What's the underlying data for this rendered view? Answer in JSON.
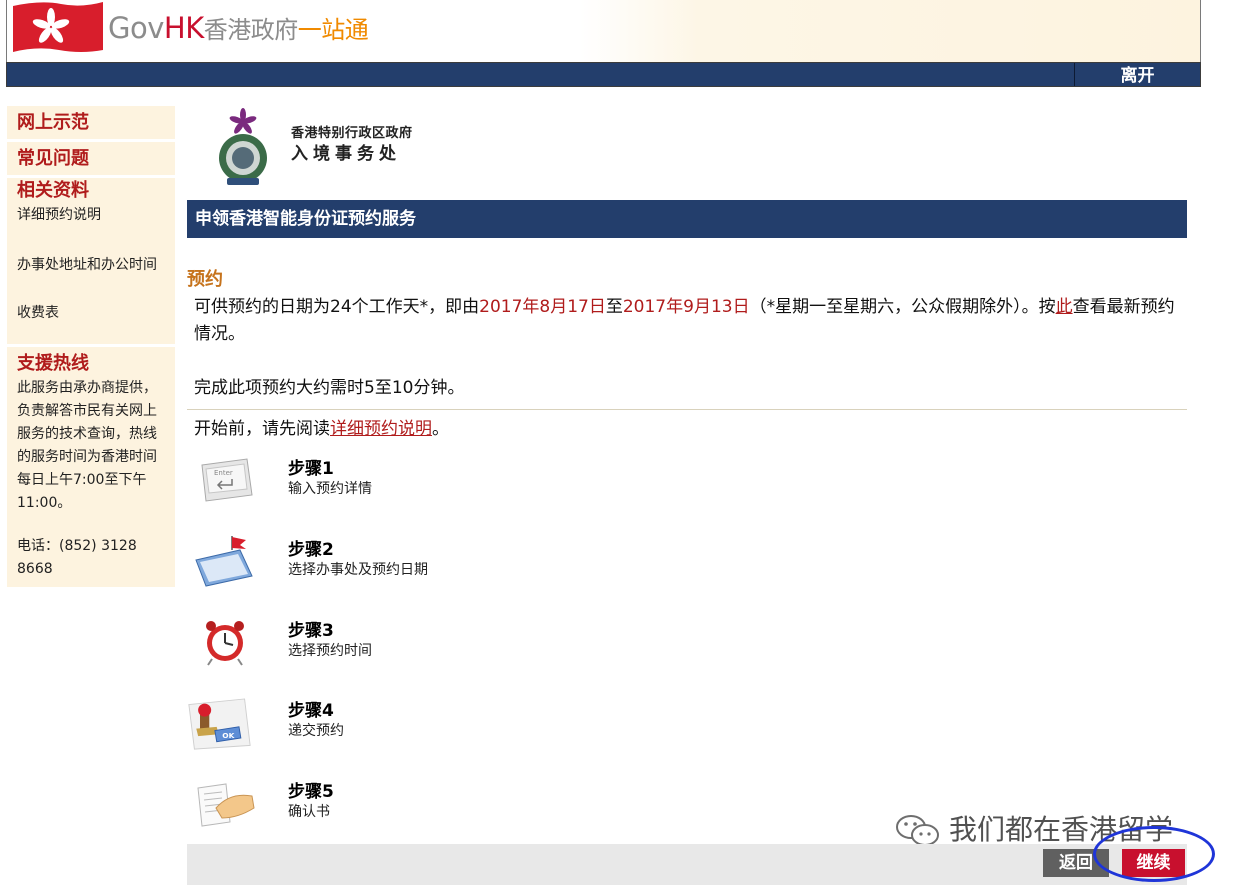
{
  "header": {
    "brand_gov": "Gov",
    "brand_hk": "HK",
    "brand_cn": "香港政府",
    "brand_cn_accent": "一站通",
    "exit_label": "离开"
  },
  "sidebar": {
    "demo": "网上示范",
    "faq": "常见问题",
    "related_head": "相关资料",
    "related_items": [
      "详细预约说明",
      "办事处地址和办公时间",
      "收费表"
    ],
    "hotline_head": "支援热线",
    "hotline_text": "此服务由承办商提供，负责解答市民有关网上服务的技术查询，热线的服务时间为香港时间每日上午7:00至下午11:00。",
    "phone": "电话：(852) 3128 8668"
  },
  "department": {
    "line1": "香港特别行政区政府",
    "line2": "入境事务处"
  },
  "page_title": "申领香港智能身份证预约服务",
  "booking": {
    "heading": "预约",
    "p1_a": "可供预约的日期为24个工作天*，即由",
    "date_from": "2017年8月17日",
    "p1_b": "至",
    "date_to": "2017年9月13日",
    "p1_c": "（*星期一至星期六，公众假期除外）。按",
    "here_link": "此",
    "p1_d": "查看最新预约情况。",
    "p2": "完成此项预约大约需时5至10分钟。",
    "p3_a": "开始前，请先阅读",
    "p3_link": "详细预约说明",
    "p3_b": "。"
  },
  "steps": [
    {
      "title": "步骤1",
      "desc": "输入预约详情",
      "icon": "keyboard-enter-icon"
    },
    {
      "title": "步骤2",
      "desc": "选择办事处及预约日期",
      "icon": "calendar-flag-icon"
    },
    {
      "title": "步骤3",
      "desc": "选择预约时间",
      "icon": "alarm-clock-icon"
    },
    {
      "title": "步骤4",
      "desc": "递交预约",
      "icon": "ok-stamp-icon"
    },
    {
      "title": "步骤5",
      "desc": "确认书",
      "icon": "handshake-document-icon"
    }
  ],
  "watermark": "我们都在香港留学",
  "buttons": {
    "back": "返回",
    "next": "继续"
  },
  "colors": {
    "navy": "#233e6c",
    "brand_red": "#c8102e",
    "section_orange": "#c6731c",
    "sidebar_bg": "#fdf3df",
    "highlight_ellipse": "#1f35d8"
  }
}
